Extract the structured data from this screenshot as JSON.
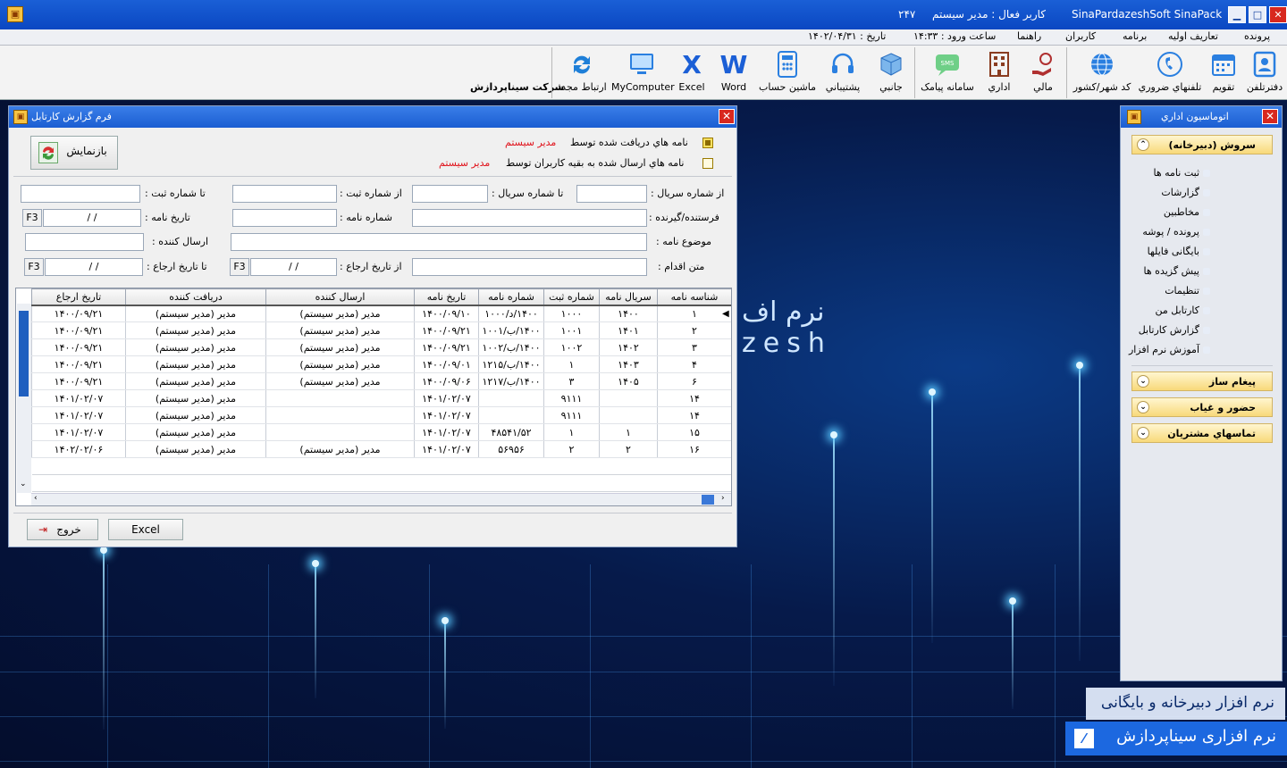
{
  "titlebar": {
    "app_title": "SinaPardazeshSoft SinaPack",
    "active_user": "کاربر فعال : مدیر سیستم",
    "number": "۲۴۷"
  },
  "info": {
    "date": "تاریخ : ۱۴۰۲/۰۴/۳۱",
    "login_time": "ساعت ورود : ۱۴:۳۳"
  },
  "menu": {
    "items": [
      "پرونده",
      "تعاریف اولیه",
      "برنامه",
      "کاربران",
      "راهنما"
    ]
  },
  "toolbar": {
    "items": [
      "دفترتلفن",
      "تقویم",
      "تلفنهاي ضروري",
      "کد شهر/کشور",
      "مالي",
      "اداري",
      "سامانه پیامک",
      "جانبي",
      "پشتیباني",
      "ماشین حساب",
      "Word",
      "Excel",
      "MyComputer",
      "ارتباط مجدد"
    ],
    "company": "شرکت سیناپردازش"
  },
  "form": {
    "title": "فرم گزارش کارتابل",
    "received_label": "نامه هاي دریافت شده توسط",
    "received_user": "مدیر سیستم",
    "sent_label": "نامه هاي ارسال شده به بقیه کاربران توسط",
    "sent_user": "مدیر سیستم",
    "refresh_label": "بازنمایش",
    "from_serial": "از شماره سریال :",
    "to_serial": "تا شماره سریال :",
    "from_reg": "از شماره ثبت :",
    "to_reg": "تا شماره ثبت :",
    "sender_receiver": "فرستنده/گیرنده :",
    "letter_no": "شماره نامه :",
    "letter_date": "تاریخ نامه :",
    "subject": "موضوع نامه :",
    "sender": "ارسال کننده :",
    "action_text": "متن اقدام :",
    "from_ref_date": "از تاریخ ارجاع :",
    "to_ref_date": "تا تاریخ ارجاع :",
    "date_placeholder": "/   /",
    "f3": "F3",
    "exit_label": "خروج",
    "excel_label": "Excel"
  },
  "table": {
    "headers": [
      "شناسه نامه",
      "سریال نامه",
      "شماره ثبت",
      "شماره نامه",
      "تاریخ نامه",
      "ارسال کننده",
      "دریافت کننده",
      "تاریخ ارجاع"
    ],
    "rows": [
      [
        "۱",
        "۱۴۰۰",
        "۱۰۰۰",
        "۱۴۰۰/د/۱۰۰۰",
        "۱۴۰۰/۰۹/۱۰",
        "مدیر (مدیر سیستم)",
        "مدیر (مدیر سیستم)",
        "۱۴۰۰/۰۹/۲۱"
      ],
      [
        "۲",
        "۱۴۰۱",
        "۱۰۰۱",
        "۱۴۰۰/ب/۱۰۰۱",
        "۱۴۰۰/۰۹/۲۱",
        "مدیر (مدیر سیستم)",
        "مدیر (مدیر سیستم)",
        "۱۴۰۰/۰۹/۲۱"
      ],
      [
        "۳",
        "۱۴۰۲",
        "۱۰۰۲",
        "۱۴۰۰/ب/۱۰۰۲",
        "۱۴۰۰/۰۹/۲۱",
        "مدیر (مدیر سیستم)",
        "مدیر (مدیر سیستم)",
        "۱۴۰۰/۰۹/۲۱"
      ],
      [
        "۴",
        "۱۴۰۳",
        "۱",
        "۱۴۰۰/ب/۱۲۱۵",
        "۱۴۰۰/۰۹/۰۱",
        "مدیر (مدیر سیستم)",
        "مدیر (مدیر سیستم)",
        "۱۴۰۰/۰۹/۲۱"
      ],
      [
        "۶",
        "۱۴۰۵",
        "۳",
        "۱۴۰۰/ب/۱۲۱۷",
        "۱۴۰۰/۰۹/۰۶",
        "مدیر (مدیر سیستم)",
        "مدیر (مدیر سیستم)",
        "۱۴۰۰/۰۹/۲۱"
      ],
      [
        "۱۴",
        "",
        "۹۱۱۱",
        "",
        "۱۴۰۱/۰۲/۰۷",
        "",
        "مدیر (مدیر سیستم)",
        "۱۴۰۱/۰۲/۰۷"
      ],
      [
        "۱۴",
        "",
        "۹۱۱۱",
        "",
        "۱۴۰۱/۰۲/۰۷",
        "",
        "مدیر (مدیر سیستم)",
        "۱۴۰۱/۰۲/۰۷"
      ],
      [
        "۱۵",
        "۱",
        "۱",
        "۴۸۵۴۱/۵۲",
        "۱۴۰۱/۰۲/۰۷",
        "",
        "مدیر (مدیر سیستم)",
        "۱۴۰۱/۰۲/۰۷"
      ],
      [
        "۱۶",
        "۲",
        "۲",
        "۵۶۹۵۶",
        "۱۴۰۱/۰۲/۰۷",
        "مدیر (مدیر سیستم)",
        "مدیر (مدیر سیستم)",
        "۱۴۰۲/۰۲/۰۶"
      ]
    ]
  },
  "panel": {
    "title": "اتوماسیون اداري",
    "groups": [
      "سروش (دبیرخانه)",
      "پیغام ساز",
      "حضور و غیاب",
      "تماسهاي مشتریان"
    ],
    "items": [
      "ثبت نامه ها",
      "گزارشات",
      "مخاطبین",
      "پرونده / پوشه",
      "بایگانی فایلها",
      "پیش گزیده ها",
      "تنظیمات",
      "کارتابل من",
      "گزارش کارتابل",
      "آموزش نرم افزار"
    ]
  },
  "background": {
    "text1": "نرم اف",
    "text2": "zesh"
  },
  "branding": {
    "line1": "نرم افزار دبیرخانه و بایگانی",
    "line2": "نرم افزاری سیناپردازش"
  },
  "colors": {
    "title_blue": "#1b5ed2",
    "accent_red": "#e0121b",
    "group_yellow": "#f8d97a"
  }
}
